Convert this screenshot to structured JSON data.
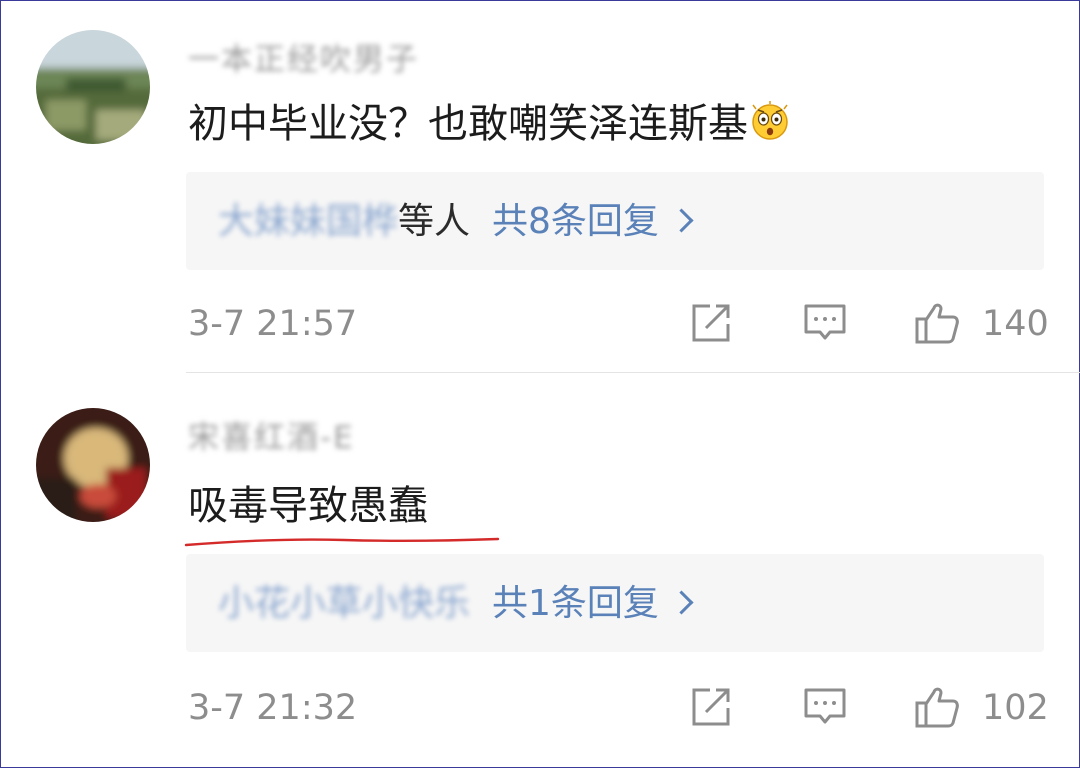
{
  "comments": [
    {
      "username": "一本正经吹男子",
      "text": "初中毕业没？也敢嘲笑泽连斯基",
      "emoji": "shocked-face-emoji",
      "reply_names": "大妹妹国桦",
      "reply_suffix": "等人",
      "reply_count": "共8条回复",
      "time": "3-7 21:57",
      "likes": "140"
    },
    {
      "username": "宋喜红酒-E",
      "text": "吸毒导致愚蠢",
      "reply_names": "小花小草小快乐",
      "reply_suffix": "",
      "reply_count": "共1条回复",
      "time": "3-7 21:32",
      "likes": "102"
    }
  ],
  "colors": {
    "link": "#5a82b8",
    "meta_gray": "#8d8d8d",
    "underline_red": "#d42a2a",
    "reply_bg": "#f6f6f6"
  }
}
